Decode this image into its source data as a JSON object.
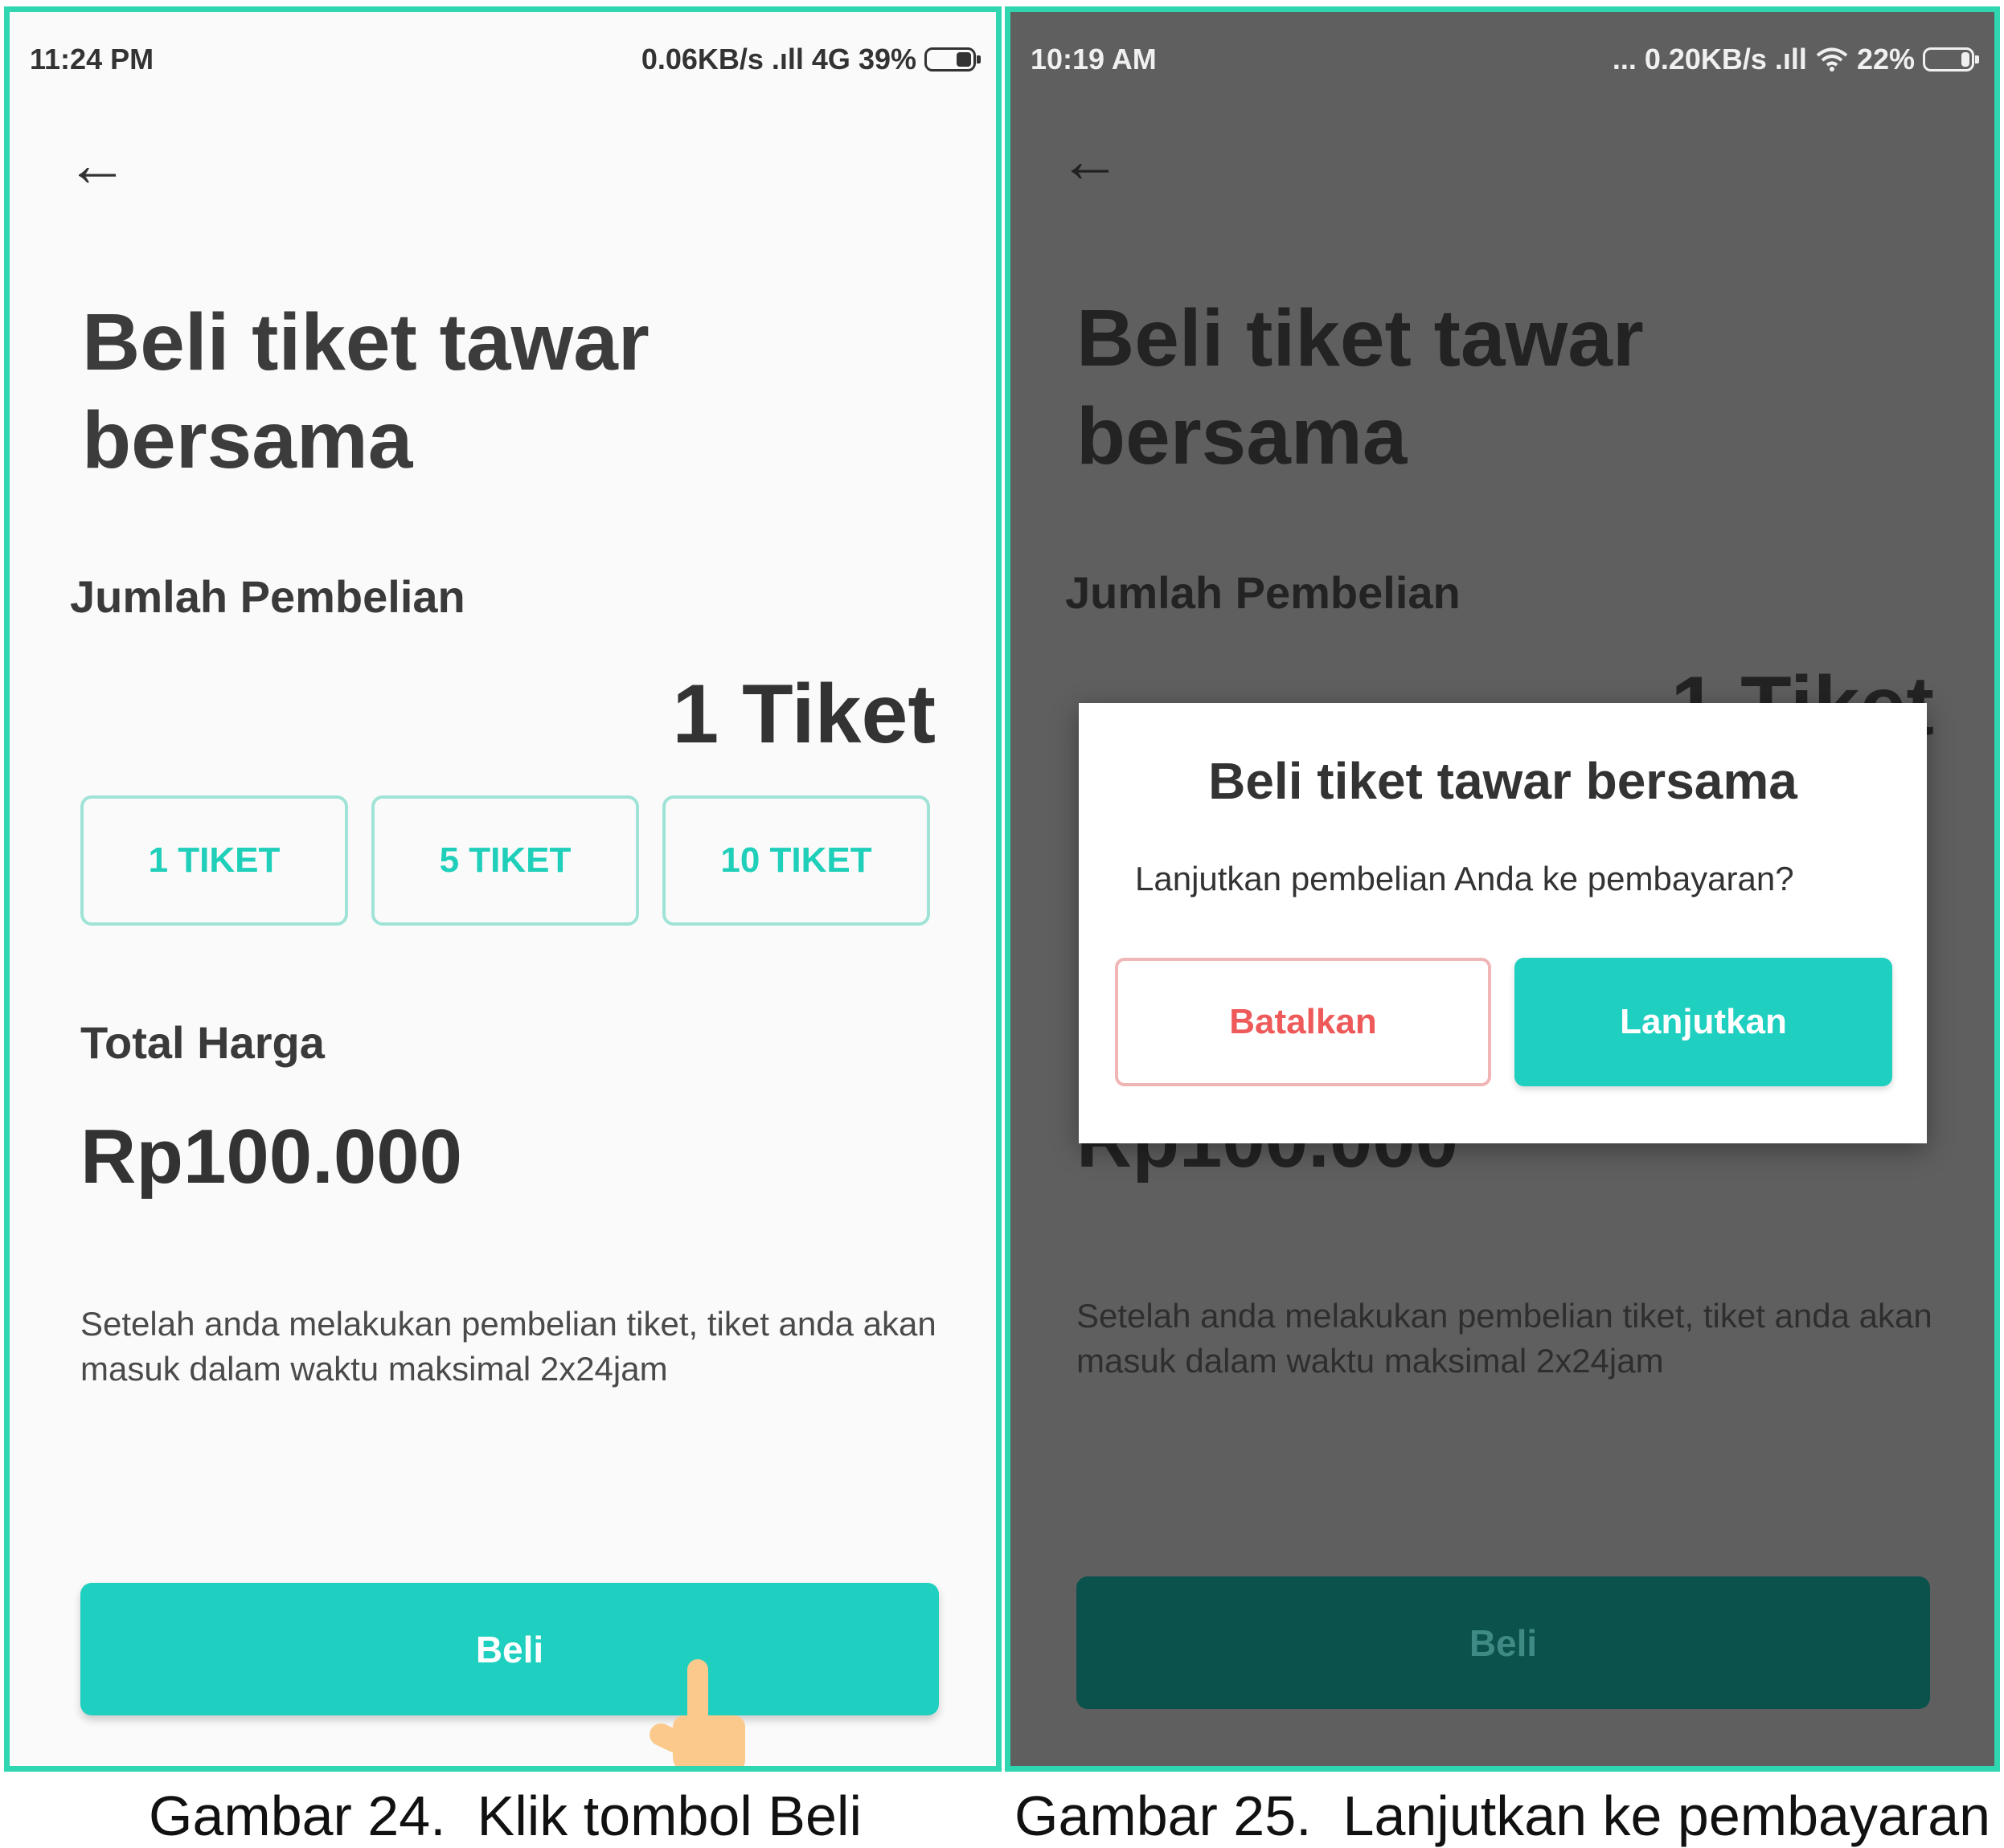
{
  "left_screen": {
    "status": {
      "time": "11:24 PM",
      "network": "0.06KB/s .ıll 4G",
      "battery": "39%"
    },
    "title": "Beli tiket tawar bersama",
    "qty_label": "Jumlah Pembelian",
    "qty_value": "1 Tiket",
    "qty_buttons": [
      "1 TIKET",
      "5 TIKET",
      "10 TIKET"
    ],
    "total_label": "Total Harga",
    "total_value": "Rp100.000",
    "note": "Setelah anda melakukan pembelian tiket, tiket anda akan masuk dalam waktu maksimal 2x24jam",
    "buy_button": "Beli"
  },
  "right_screen": {
    "status": {
      "time": "10:19 AM",
      "network": "... 0.20KB/s .ıll",
      "battery": "22%"
    },
    "title": "Beli tiket tawar bersama",
    "qty_label": "Jumlah Pembelian",
    "qty_value": "1 Tiket",
    "total_value": "Rp100.000",
    "note": "Setelah anda melakukan pembelian tiket, tiket anda akan masuk dalam waktu maksimal 2x24jam",
    "buy_button": "Beli",
    "dialog": {
      "title": "Beli tiket tawar bersama",
      "message": "Lanjutkan pembelian Anda ke pembayaran?",
      "cancel_button": "Batalkan",
      "continue_button": "Lanjutkan"
    }
  },
  "captions": {
    "left": "Gambar 24.  Klik tombol Beli",
    "right": "Gambar 25.  Lanjutkan ke pembayaran"
  },
  "colors": {
    "frame_border": "#2fd6b0",
    "accent": "#1fcfbf",
    "cancel_text": "#ee5a5a",
    "overlay": "#5f5f5f"
  },
  "icons": {
    "back": "arrow-left-icon",
    "pointer": "pointing-hand-icon",
    "wifi": "wifi-icon"
  }
}
